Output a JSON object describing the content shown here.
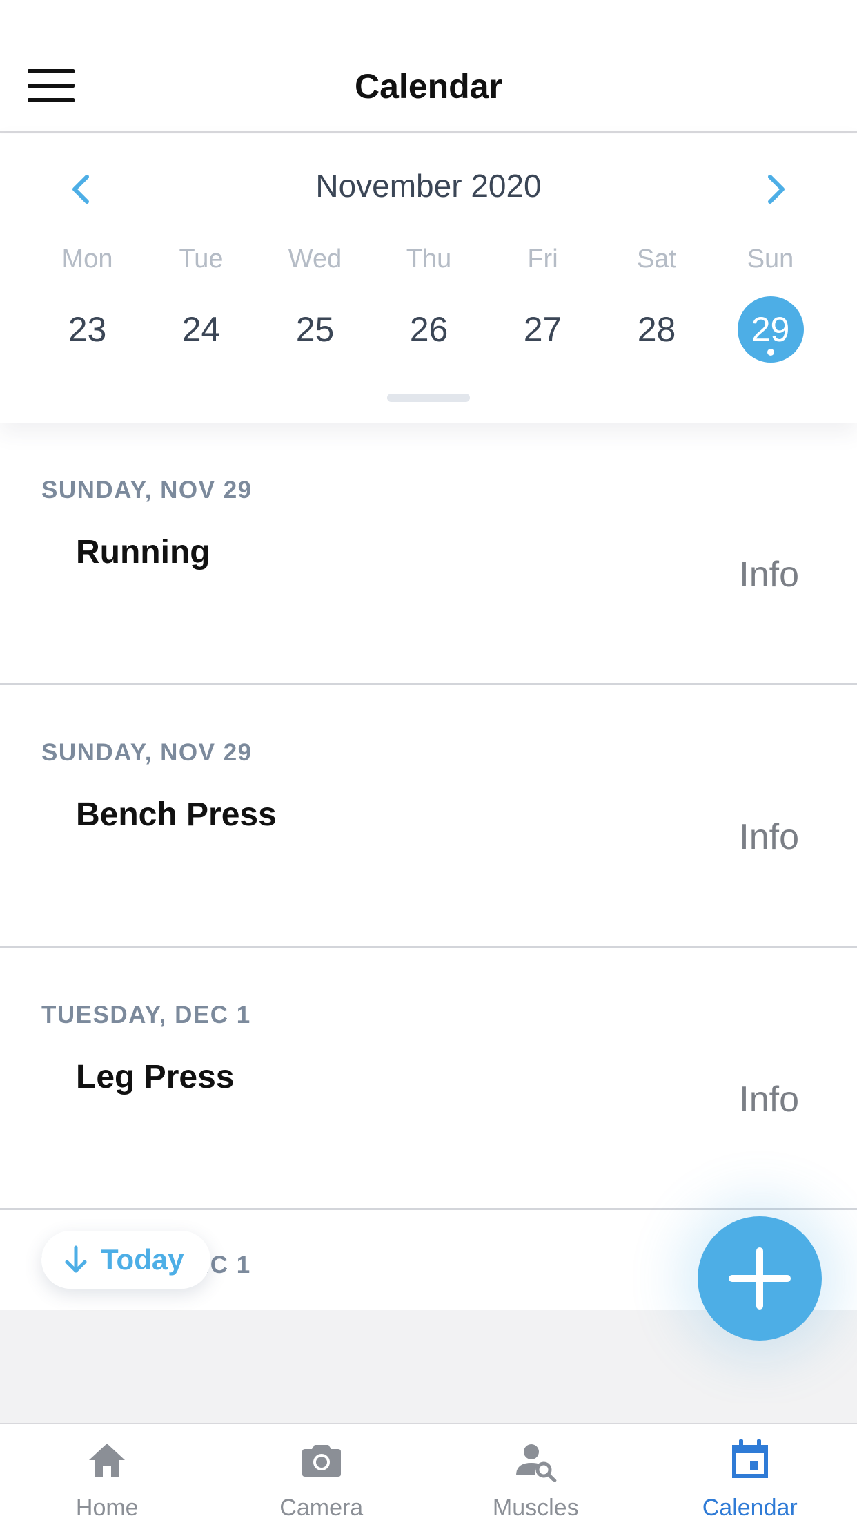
{
  "header": {
    "title": "Calendar",
    "menu_icon": "hamburger-menu-icon"
  },
  "calendar": {
    "month_label": "November 2020",
    "weekdays": [
      "Mon",
      "Tue",
      "Wed",
      "Thu",
      "Fri",
      "Sat",
      "Sun"
    ],
    "days": [
      "23",
      "24",
      "25",
      "26",
      "27",
      "28",
      "29"
    ],
    "selected_day": "29",
    "accent_color": "#4daee6"
  },
  "agenda": {
    "sections": [
      {
        "date": "SUNDAY, NOV 29",
        "title": "Running",
        "action": "Info"
      },
      {
        "date": "SUNDAY, NOV 29",
        "title": "Bench Press",
        "action": "Info"
      },
      {
        "date": "TUESDAY, DEC 1",
        "title": "Leg Press",
        "action": "Info"
      },
      {
        "date": "TUESDAY, DEC 1"
      }
    ]
  },
  "today_button": {
    "label": "Today",
    "icon": "arrow-down-icon"
  },
  "fab": {
    "icon": "plus-icon"
  },
  "tabbar": {
    "tabs": [
      {
        "label": "Home",
        "icon": "home-icon",
        "active": false
      },
      {
        "label": "Camera",
        "icon": "camera-icon",
        "active": false
      },
      {
        "label": "Muscles",
        "icon": "muscle-search-icon",
        "active": false
      },
      {
        "label": "Calendar",
        "icon": "calendar-icon",
        "active": true
      }
    ],
    "active_color": "#2f7bd6",
    "inactive_color": "#8b8f96"
  }
}
